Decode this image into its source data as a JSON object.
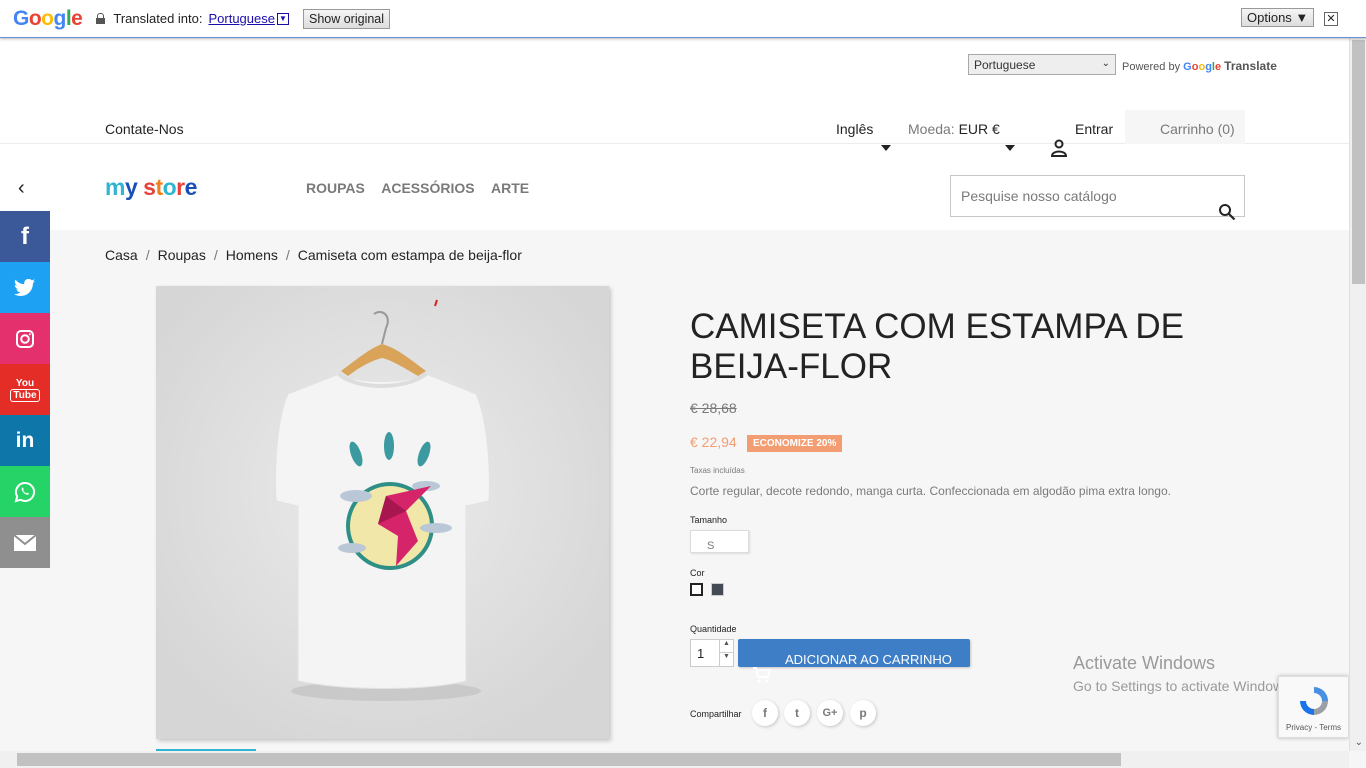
{
  "translate_bar": {
    "translated_into": "Translated into:",
    "language": "Portuguese",
    "show_original": "Show original",
    "options": "Options ▼"
  },
  "google_select": {
    "value": "Portuguese",
    "powered_by": "Powered by",
    "translate": "Translate"
  },
  "topnav": {
    "contact": "Contate-Nos",
    "language": "Inglês",
    "currency_label": "Moeda:",
    "currency_value": "EUR €",
    "sign_in": "Entrar",
    "cart": "Carrinho (0)"
  },
  "menu": {
    "items": [
      "ROUPAS",
      "ACESSÓRIOS",
      "ARTE"
    ]
  },
  "search": {
    "placeholder": "Pesquise nosso catálogo"
  },
  "breadcrumb": [
    "Casa",
    "Roupas",
    "Homens",
    "Camiseta com estampa de beija-flor"
  ],
  "product": {
    "title": "CAMISETA COM ESTAMPA DE BEIJA-FLOR",
    "old_price": "€ 28,68",
    "price": "€ 22,94",
    "discount": "ECONOMIZE 20%",
    "tax": "Taxas incluídas",
    "description": "Corte regular, decote redondo, manga curta. Confeccionada em algodão pima extra longo.",
    "size_label": "Tamanho",
    "size_value": "S",
    "color_label": "Cor",
    "quantity_label": "Quantidade",
    "quantity": "1",
    "add_to_cart": "ADICIONAR AO CARRINHO",
    "share_label": "Compartilhar",
    "colors": [
      "#ffffff",
      "#434a54"
    ]
  },
  "social_icons": [
    "facebook-icon",
    "twitter-icon",
    "instagram-icon",
    "youtube-icon",
    "linkedin-icon",
    "whatsapp-icon",
    "email-icon"
  ],
  "youtube_text": [
    "You",
    "Tube"
  ],
  "share_icons": [
    "f",
    "t",
    "G+",
    "p"
  ],
  "windows_notice": {
    "line1": "Activate Windows",
    "line2": "Go to Settings to activate Windows."
  },
  "recaptcha": {
    "links": "Privacy - Terms"
  }
}
